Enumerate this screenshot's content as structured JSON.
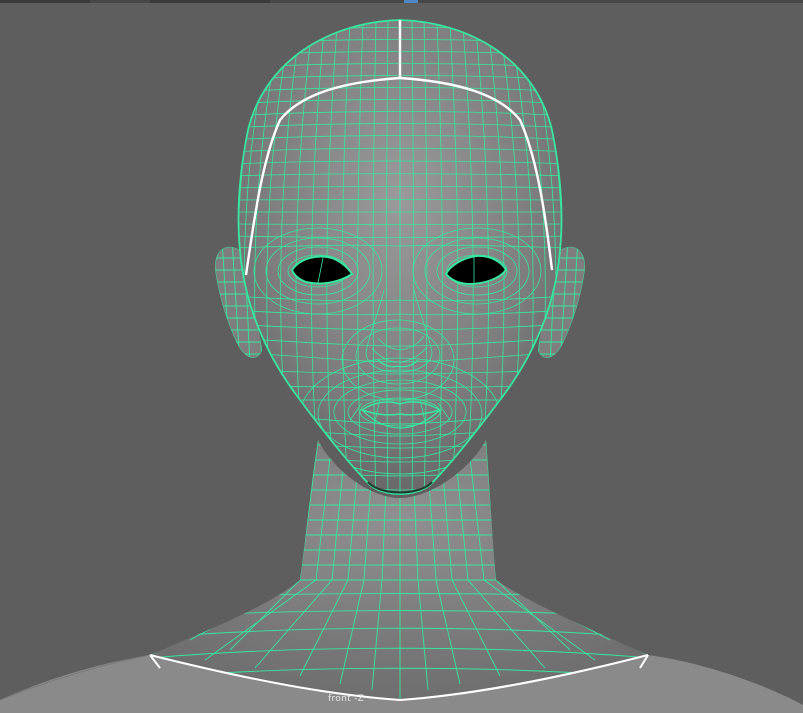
{
  "viewport": {
    "camera_label": "front -Z",
    "background_color": "#5e5e5e",
    "wire_color": "#38e6a0",
    "selection_color": "#ffffff",
    "shade_color": "#8c8c8c"
  },
  "model": {
    "kind": "head-and-neck-mesh",
    "display": "wireframe-on-shaded",
    "selected_edge_loops": [
      "scalp-loop",
      "scalp-center-seam",
      "collar-loop"
    ]
  }
}
